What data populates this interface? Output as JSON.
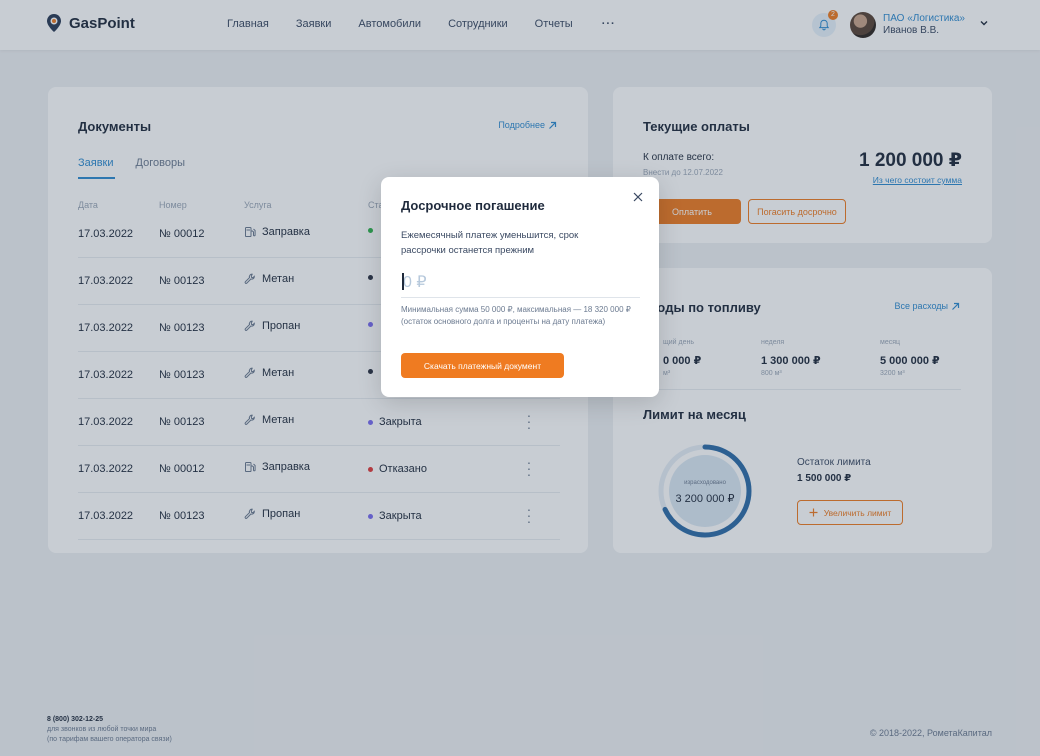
{
  "header": {
    "logo_text": "GasPoint",
    "nav": [
      "Главная",
      "Заявки",
      "Автомобили",
      "Сотрудники",
      "Отчеты"
    ],
    "nav_more": "···",
    "notification_count": "2",
    "company": "ПАО «Логистика»",
    "user": "Иванов В.В."
  },
  "documents": {
    "title": "Документы",
    "more_link": "Подробнее",
    "tabs": [
      "Заявки",
      "Договоры"
    ],
    "active_tab": "Заявки",
    "columns": [
      "Дата",
      "Номер",
      "Услуга",
      "Ста"
    ],
    "rows": [
      {
        "date": "17.03.2022",
        "number": "№ 00012",
        "service": "Заправка",
        "service_icon": "fuel-pump-icon",
        "status": "",
        "status_color": "#2fb24c"
      },
      {
        "date": "17.03.2022",
        "number": "№ 00123",
        "service": "Метан",
        "service_icon": "wrench-icon",
        "status": "",
        "status_color": "#2a3142"
      },
      {
        "date": "17.03.2022",
        "number": "№ 00123",
        "service": "Пропан",
        "service_icon": "wrench-icon",
        "status": "",
        "status_color": "#7a6cf0"
      },
      {
        "date": "17.03.2022",
        "number": "№ 00123",
        "service": "Метан",
        "service_icon": "wrench-icon",
        "status": "",
        "status_color": "#2a3142"
      },
      {
        "date": "17.03.2022",
        "number": "№ 00123",
        "service": "Метан",
        "service_icon": "wrench-icon",
        "status": "Закрыта",
        "status_color": "#7a6cf0"
      },
      {
        "date": "17.03.2022",
        "number": "№ 00012",
        "service": "Заправка",
        "service_icon": "fuel-pump-icon",
        "status": "Отказано",
        "status_color": "#e23b3b"
      },
      {
        "date": "17.03.2022",
        "number": "№ 00123",
        "service": "Пропан",
        "service_icon": "wrench-icon",
        "status": "Закрыта",
        "status_color": "#7a6cf0"
      }
    ]
  },
  "payments": {
    "title": "Текущие оплаты",
    "total_label": "К оплате всего:",
    "due": "Внести до 12.07.2022",
    "amount": "1 200 000 ₽",
    "breakdown_link": "Из чего состоит сумма",
    "pay_button": "Оплатить",
    "early_button": "Погасить досрочно"
  },
  "fuel": {
    "title": "схoды по топливу",
    "all_link": "Все расходы",
    "stats": [
      {
        "label": "щий день",
        "value": "0 000 ₽",
        "sub": "м³"
      },
      {
        "label": "неделя",
        "value": "1 300 000 ₽",
        "sub": "800 м³"
      },
      {
        "label": "месяц",
        "value": "5 000 000 ₽",
        "sub": "3200 м³"
      }
    ],
    "limit_title": "Лимит на месяц",
    "spent_label": "израсходовано",
    "spent_value": "3 200 000 ₽",
    "spent_fraction": 0.68,
    "rest_label": "Остаток лимита",
    "rest_value": "1 500 000 ₽",
    "increase_button": "Увеличить лимит"
  },
  "footer": {
    "phone": "8 (800) 302-12-25",
    "note1": "для звонков из любой точки мира",
    "note2": "(по тарифам вашего оператора связи)",
    "copyright": "© 2018-2022, РометаКапитал"
  },
  "modal": {
    "title": "Досрочное погашение",
    "description": "Ежемесячный платеж уменьшится, срок рассрочки останется прежним",
    "input_placeholder": "0 ₽",
    "hint": "Минимальная сумма 50 000 ₽, максимальная — 18 320 000 ₽ (остаток основного долга и проценты на дату платежа)",
    "button": "Скачать платежный документ"
  },
  "colors": {
    "accent": "#ef7b21",
    "link": "#2f8bd0",
    "ring": "#2f6da8",
    "ring_track": "#e6eef6"
  }
}
